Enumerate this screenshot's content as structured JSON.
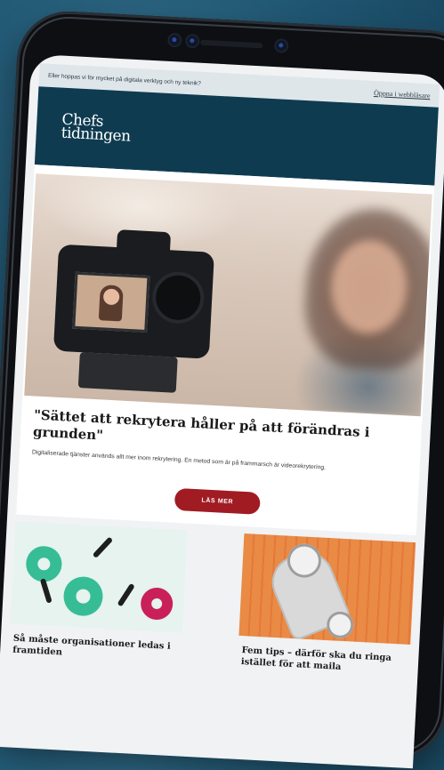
{
  "preheader": {
    "text": "Eller hoppas vi för mycket på digitala verktyg och ny teknik?",
    "link": "Öppna i webbläsare"
  },
  "header": {
    "logo_line1": "Chefs",
    "logo_line2": "tidningen"
  },
  "hero": {
    "title": "\"Sättet att rekrytera håller på att förändras i grunden\"",
    "description": "Digitaliserade tjänster används allt mer inom rekrytering. En metod som är på frammarsch är videorekrytering.",
    "button": "LÄS MER"
  },
  "cards": [
    {
      "title": "Så måste organisationer ledas i framtiden"
    },
    {
      "title": "Fem tips – därför ska du ringa istället för att maila"
    }
  ],
  "colors": {
    "header_bg": "#0f3b50",
    "button_bg": "#a11b23",
    "gear_green": "#37bd96",
    "gear_pink": "#c9205a",
    "stripe_orange": "#e98a45"
  }
}
